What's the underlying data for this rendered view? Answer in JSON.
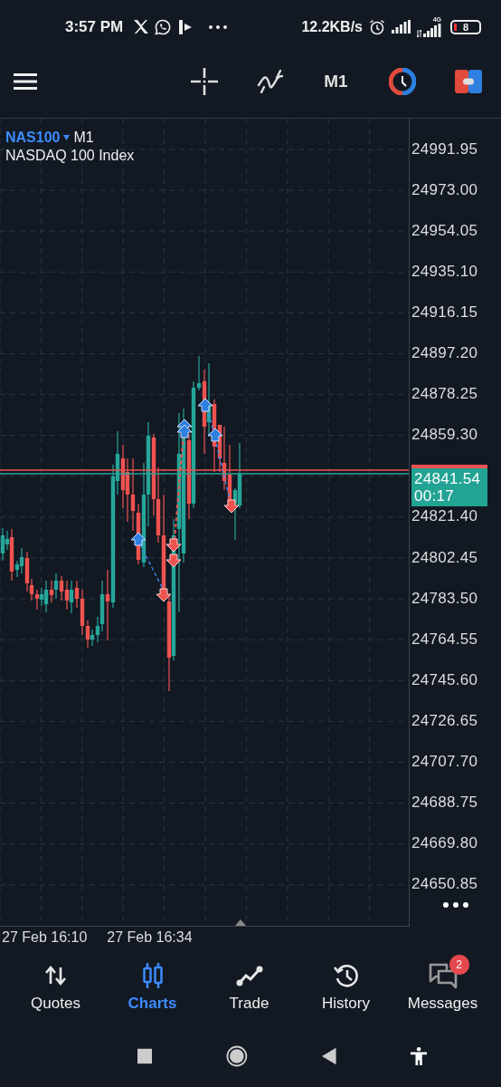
{
  "status_bar": {
    "time": "3:57 PM",
    "net_speed": "12.2KB/s",
    "network_type": "4G",
    "battery": "8"
  },
  "toolbar": {
    "timeframe": "M1"
  },
  "chart": {
    "symbol": "NAS100",
    "timeframe": "M1",
    "description": "NASDAQ 100 Index",
    "price_labels": [
      "24991.95",
      "24973.00",
      "24954.05",
      "24935.10",
      "24916.15",
      "24897.20",
      "24878.25",
      "24859.30",
      "24821.40",
      "24802.45",
      "24783.50",
      "24764.55",
      "24745.60",
      "24726.65",
      "24707.70",
      "24688.75",
      "24669.80",
      "24650.85"
    ],
    "current_price": "24841.54",
    "countdown": "00:17",
    "time_labels": [
      "27 Feb 16:10",
      "27 Feb 16:34"
    ]
  },
  "nav": [
    {
      "label": "Quotes",
      "kind": "quotes",
      "selected": false
    },
    {
      "label": "Charts",
      "kind": "charts",
      "selected": true
    },
    {
      "label": "Trade",
      "kind": "trade",
      "selected": false
    },
    {
      "label": "History",
      "kind": "history",
      "selected": false
    },
    {
      "label": "Messages",
      "kind": "messages",
      "selected": false,
      "badge": "2"
    }
  ]
}
